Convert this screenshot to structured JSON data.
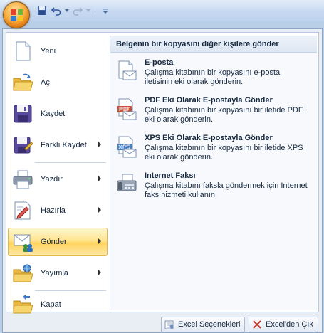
{
  "quick_access": {
    "items": [
      "save-icon",
      "undo-icon",
      "redo-icon",
      "customize-icon"
    ]
  },
  "menu": {
    "items": [
      {
        "label": "Yeni",
        "icon": "new-document-icon",
        "has_submenu": false
      },
      {
        "label": "Aç",
        "icon": "open-folder-icon",
        "has_submenu": false
      },
      {
        "label": "Kaydet",
        "icon": "save-icon",
        "has_submenu": false
      },
      {
        "label": "Farklı Kaydet",
        "icon": "save-as-icon",
        "has_submenu": true
      },
      {
        "label": "Yazdır",
        "icon": "print-icon",
        "has_submenu": true
      },
      {
        "label": "Hazırla",
        "icon": "prepare-icon",
        "has_submenu": true
      },
      {
        "label": "Gönder",
        "icon": "send-icon",
        "has_submenu": true,
        "active": true
      },
      {
        "label": "Yayımla",
        "icon": "publish-icon",
        "has_submenu": true
      },
      {
        "label": "Kapat",
        "icon": "close-document-icon",
        "has_submenu": false
      }
    ]
  },
  "submenu": {
    "title": "Belgenin bir kopyasını diğer kişilere gönder",
    "items": [
      {
        "title": "E-posta",
        "desc": "Çalışma kitabının bir kopyasını e-posta iletisinin eki olarak gönderin.",
        "icon": "email-icon"
      },
      {
        "title": "PDF Eki Olarak E-postayla Gönder",
        "desc": "Çalışma kitabının bir kopyasını bir iletide PDF eki olarak gönderin.",
        "icon": "pdf-icon"
      },
      {
        "title": "XPS Eki Olarak E-postayla Gönder",
        "desc": "Çalışma kitabının bir kopyasını bir iletide XPS eki olarak gönderin.",
        "icon": "xps-icon"
      },
      {
        "title": "Internet Faksı",
        "desc": "Çalışma kitabını faksla göndermek için Internet faks hizmeti kullanın.",
        "icon": "fax-icon"
      }
    ]
  },
  "footer": {
    "options_label": "Excel Seçenekleri",
    "exit_label": "Excel'den Çık"
  },
  "colors": {
    "active_highlight": "#ffd35e",
    "office_button": "#f9b64a",
    "menu_bg": "#ffffff"
  }
}
